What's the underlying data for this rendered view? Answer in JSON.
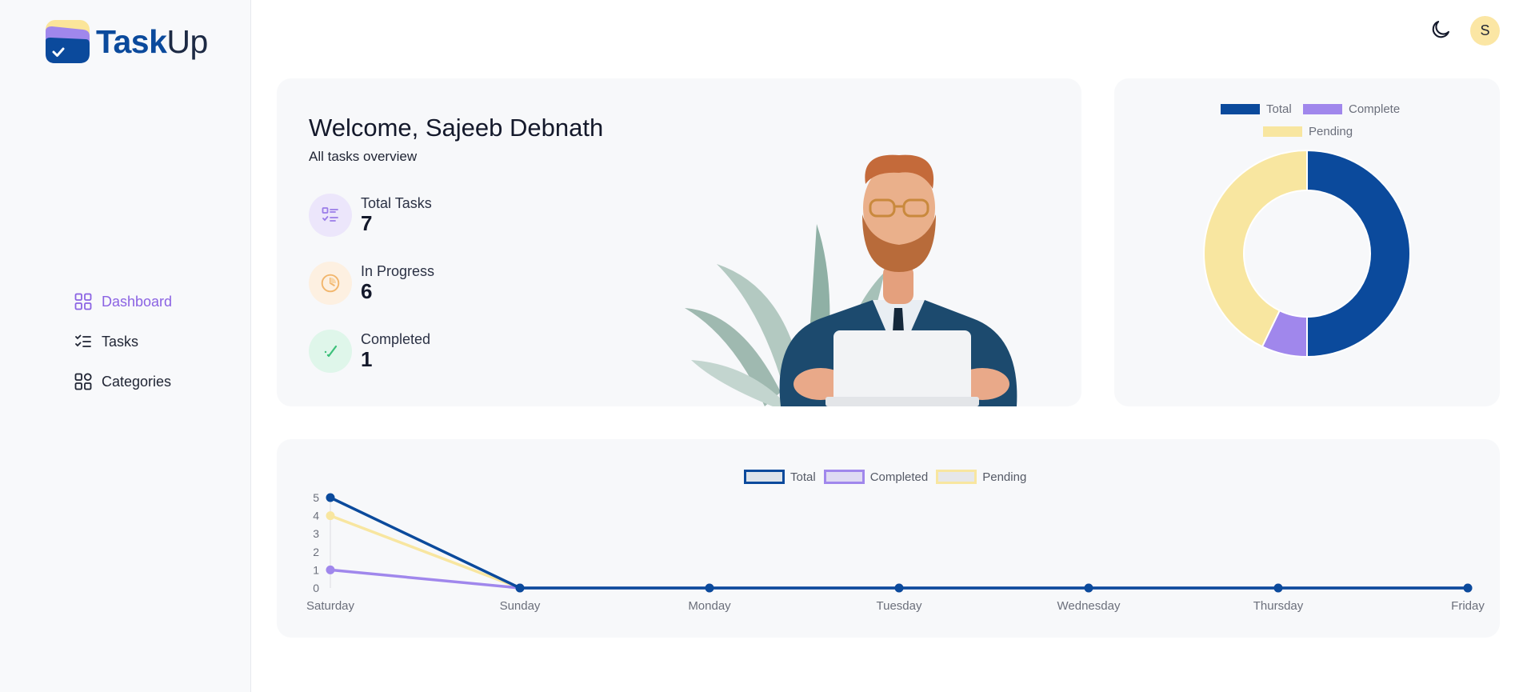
{
  "app": {
    "logo_task": "Task",
    "logo_up": "Up"
  },
  "sidebar": {
    "items": [
      {
        "label": "Dashboard",
        "icon": "dashboard-icon",
        "active": true
      },
      {
        "label": "Tasks",
        "icon": "tasks-icon",
        "active": false
      },
      {
        "label": "Categories",
        "icon": "categories-icon",
        "active": false
      }
    ]
  },
  "topbar": {
    "theme_icon": "moon-icon",
    "avatar_initial": "S"
  },
  "welcome": {
    "title": "Welcome, Sajeeb Debnath",
    "subtitle": "All tasks overview",
    "stats": [
      {
        "label": "Total Tasks",
        "value": "7",
        "icon": "checklist-icon",
        "bg": "#ece6fb",
        "color": "#9a7ce8"
      },
      {
        "label": "In Progress",
        "value": "6",
        "icon": "pie-clock-icon",
        "bg": "#fdf0e1",
        "color": "#f2b66d"
      },
      {
        "label": "Completed",
        "value": "1",
        "icon": "pen-check-icon",
        "bg": "#dff6ea",
        "color": "#3cc07a"
      }
    ]
  },
  "colors": {
    "total": "#0b4a9c",
    "complete": "#a087ec",
    "pending": "#f8e6a0"
  },
  "chart_data": [
    {
      "type": "pie",
      "variant": "doughnut",
      "legend": [
        "Total",
        "Complete",
        "Pending"
      ],
      "values": [
        7,
        1,
        6
      ],
      "colors": [
        "#0b4a9c",
        "#a087ec",
        "#f8e6a0"
      ],
      "legend_position": "top"
    },
    {
      "type": "line",
      "categories": [
        "Saturday",
        "Sunday",
        "Monday",
        "Tuesday",
        "Wednesday",
        "Thursday",
        "Friday"
      ],
      "series": [
        {
          "name": "Total",
          "values": [
            5,
            0,
            0,
            0,
            0,
            0,
            0
          ],
          "color": "#0b4a9c"
        },
        {
          "name": "Completed",
          "values": [
            1,
            0,
            0,
            0,
            0,
            0,
            0
          ],
          "color": "#a087ec"
        },
        {
          "name": "Pending",
          "values": [
            4,
            0,
            0,
            0,
            0,
            0,
            0
          ],
          "color": "#f8e6a0"
        }
      ],
      "yticks": [
        "0",
        "1",
        "2",
        "3",
        "4",
        "5"
      ],
      "ylim": [
        0,
        5
      ],
      "legend_position": "top"
    }
  ]
}
